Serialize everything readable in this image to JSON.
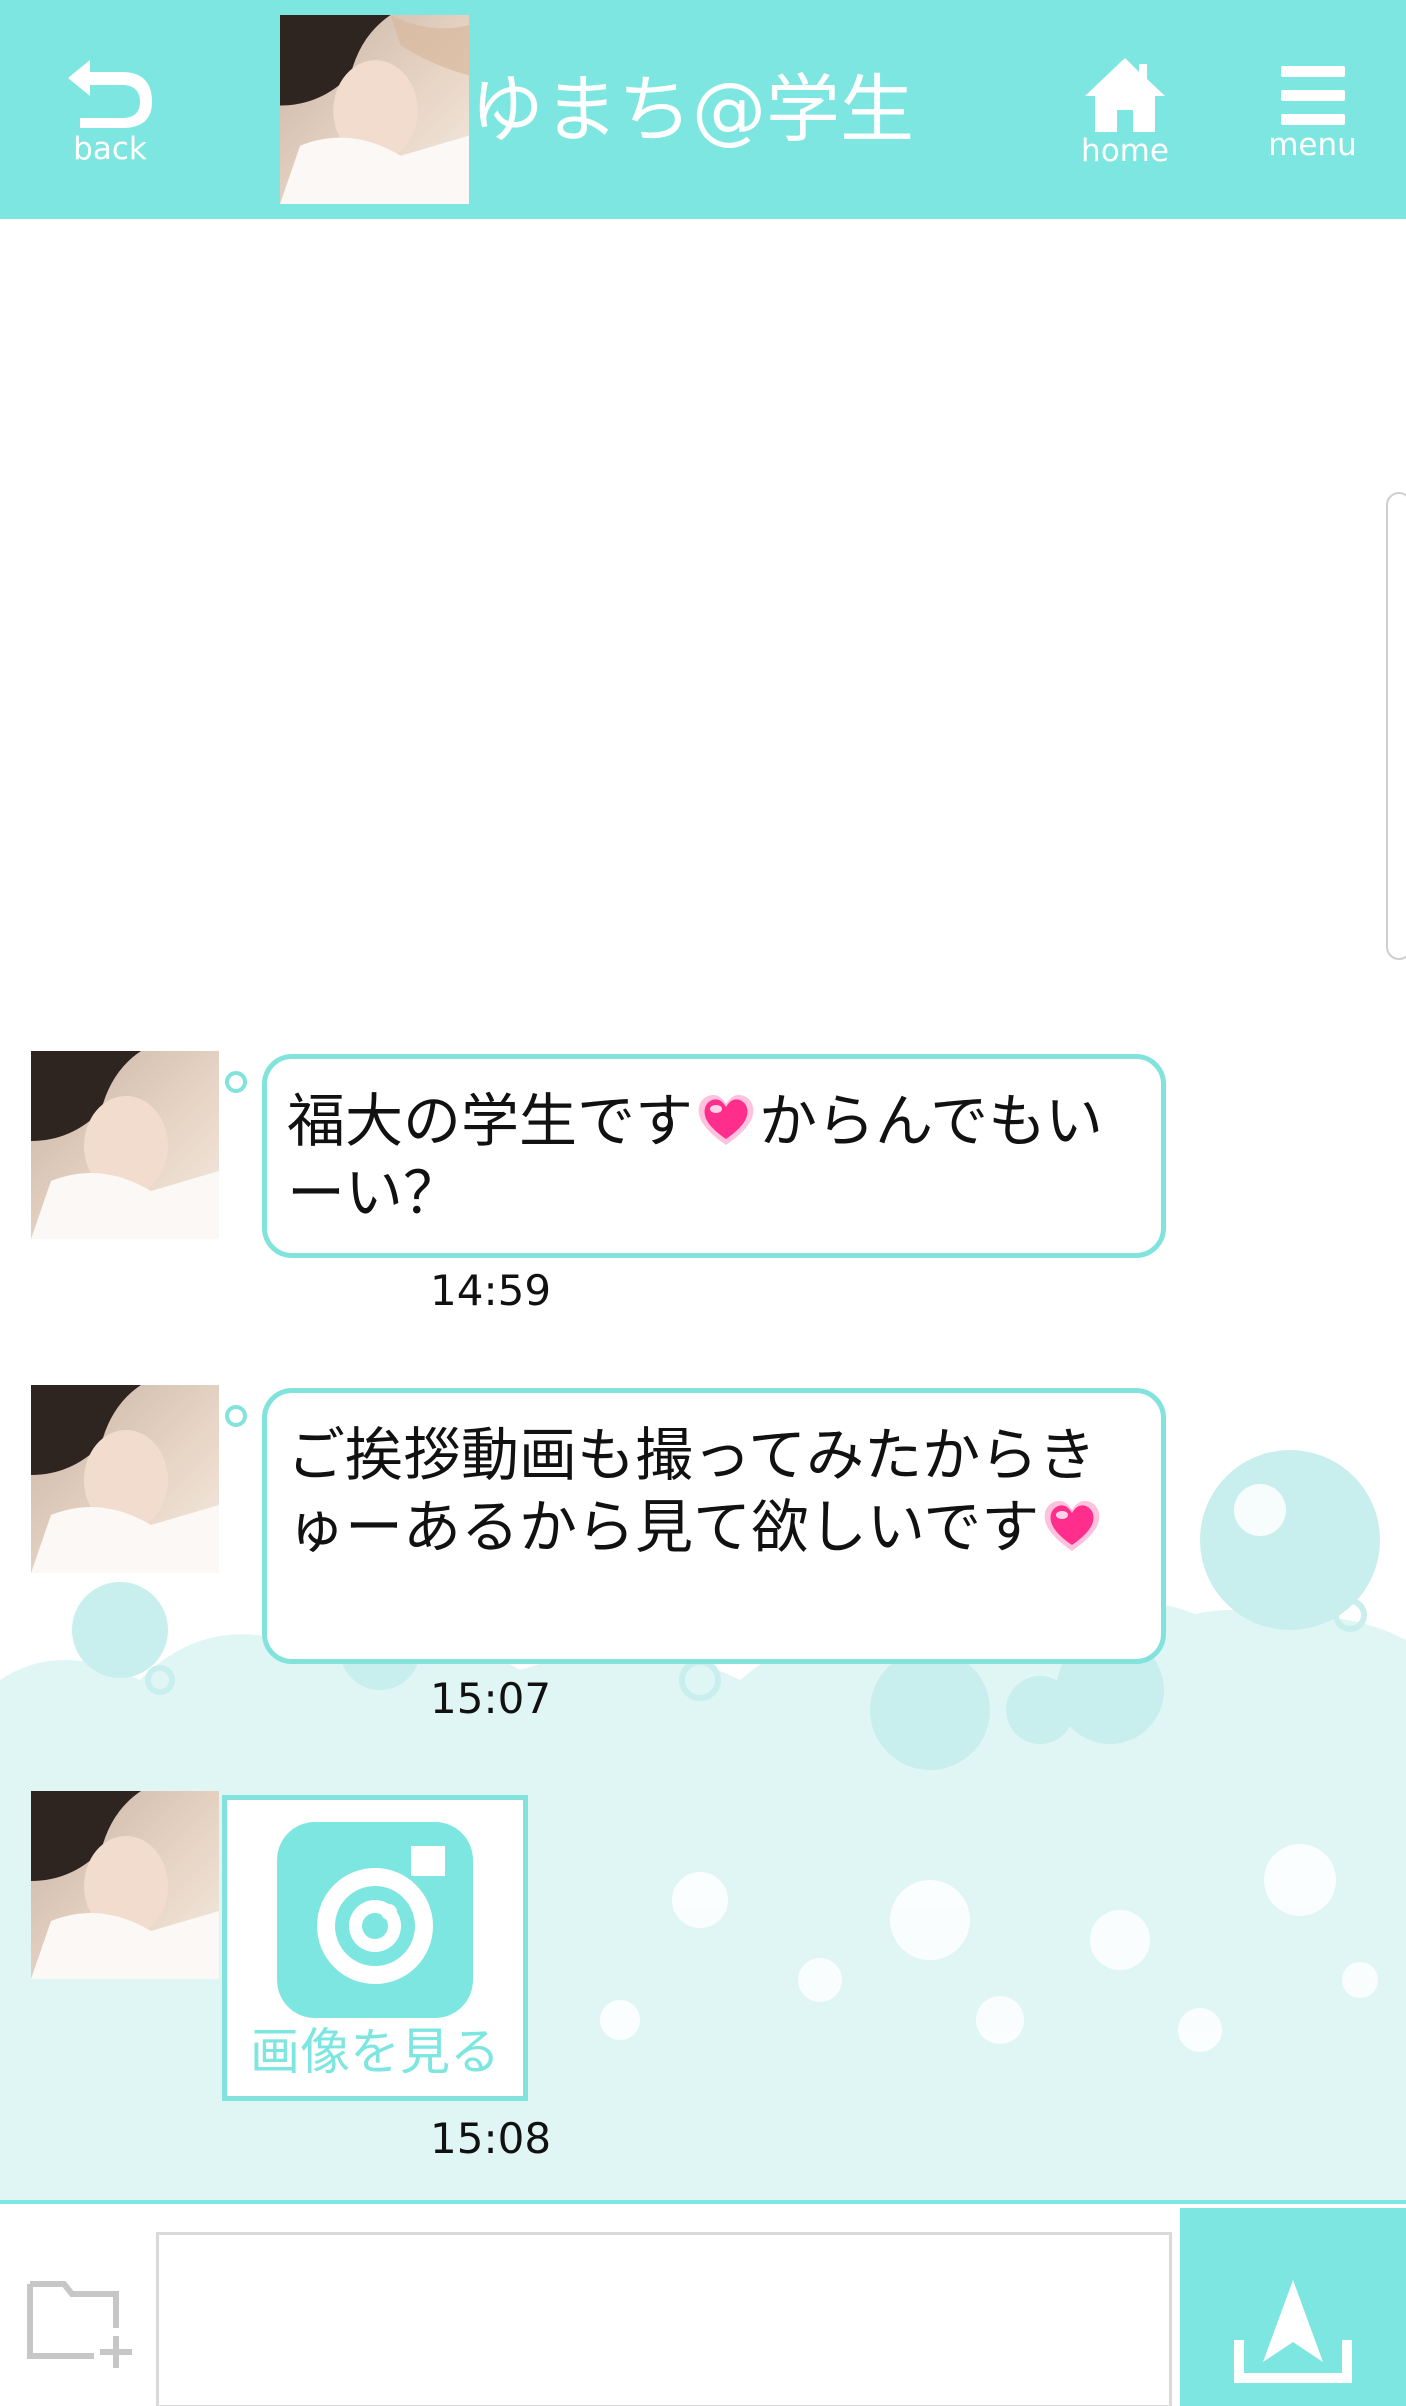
{
  "header": {
    "back_label": "back",
    "home_label": "home",
    "menu_label": "menu",
    "contact_name": "ゆまち@学生"
  },
  "messages": [
    {
      "text_before_emoji": "福大の学生です",
      "text_after_emoji": "からんでもいーい？",
      "emoji": "heart-emoji",
      "time": "14:59"
    },
    {
      "text_before_emoji": "ご挨拶動画も撮ってみたからきゅーあるから見て欲しいです",
      "text_after_emoji": "",
      "emoji": "heart-emoji",
      "time": "15:07"
    },
    {
      "type": "image",
      "label": "画像を見る",
      "icon": "camera-icon",
      "time": "15:08"
    }
  ],
  "input": {
    "placeholder": "",
    "value": "",
    "attach_icon": "folder-add-icon",
    "send_icon": "send-icon"
  },
  "colors": {
    "accent": "#7ee6e0",
    "bubble_border": "#82e2dc",
    "heart_pink": "#ff2e8c"
  }
}
